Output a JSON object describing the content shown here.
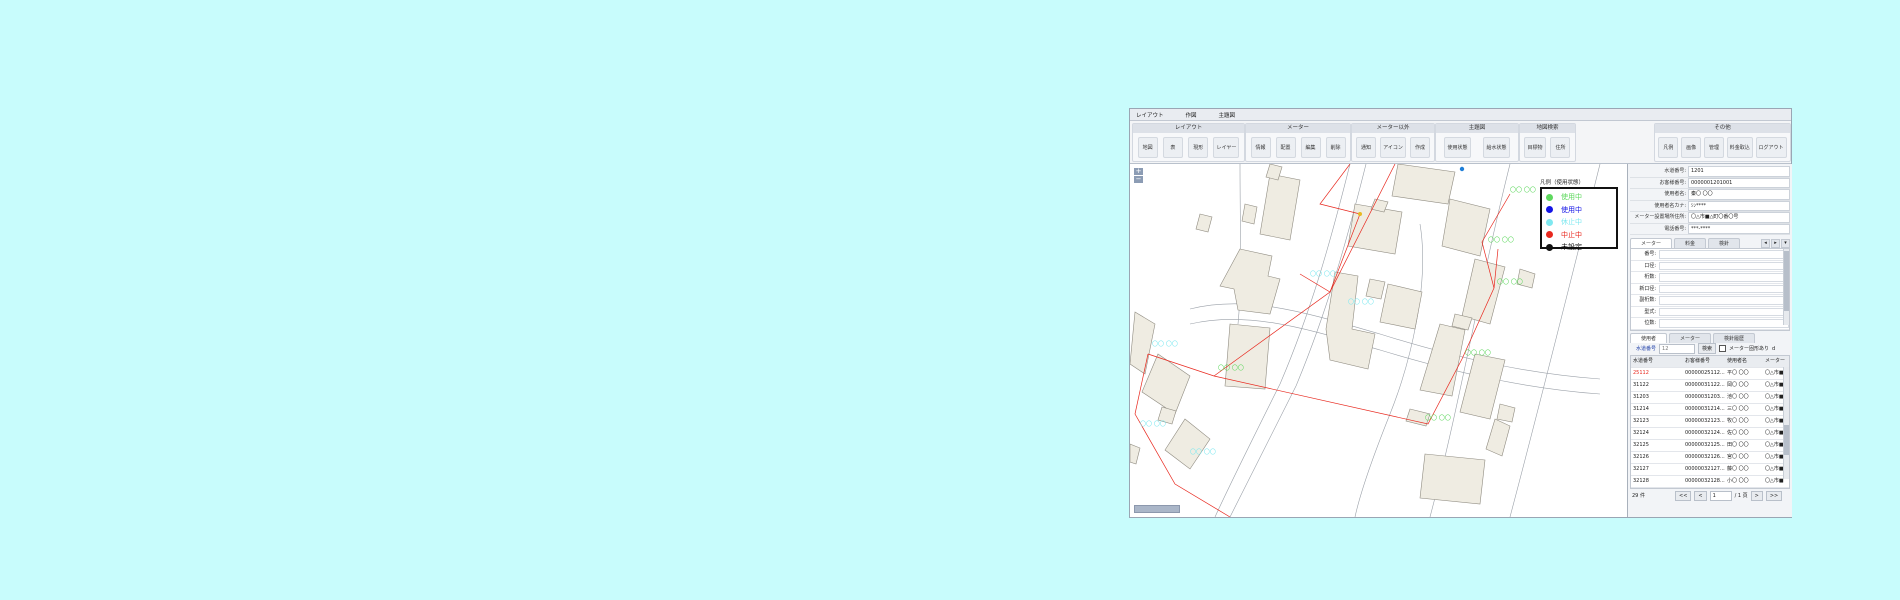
{
  "menubar": [
    "レイアウト",
    "作図",
    "主題図"
  ],
  "ribbon": {
    "groups": [
      {
        "title": "レイアウト",
        "buttons": [
          "地図",
          "表",
          "現形",
          "レイヤー"
        ]
      },
      {
        "title": "メーター",
        "buttons": [
          "情報",
          "配置",
          "編集",
          "削除"
        ]
      },
      {
        "title": "メーター以外",
        "buttons": [
          "通知",
          "アイコン",
          "作成"
        ]
      },
      {
        "title": "主題図",
        "buttons": [
          "使用状態",
          "給水状態"
        ]
      },
      {
        "title": "地図検索",
        "buttons": [
          "目標物",
          "住所"
        ]
      },
      {
        "title": "その他",
        "buttons": [
          "凡例",
          "画像",
          "管理",
          "料金取込",
          "ログアウト"
        ]
      }
    ]
  },
  "map": {
    "zoom_in": "+",
    "zoom_out": "−",
    "legend": {
      "title": "凡例（使用状態）",
      "items": [
        {
          "label": "使用中",
          "color": "#5ed85e"
        },
        {
          "label": "使用中",
          "color": "#1414e6"
        },
        {
          "label": "休止中",
          "color": "#7fe8f0"
        },
        {
          "label": "中止中",
          "color": "#e8281e"
        },
        {
          "label": "未設定",
          "color": "#111111"
        }
      ]
    }
  },
  "info": [
    {
      "label": "水道番号:",
      "value": "1201"
    },
    {
      "label": "お客様番号:",
      "value": "0000001201001"
    },
    {
      "label": "使用者名:",
      "value": "秦〇 〇〇"
    },
    {
      "label": "使用者名カナ:",
      "value": "ｼﾝ****"
    },
    {
      "label": "メーター設置場所住所:",
      "value": "〇△市■△町〇番〇号"
    },
    {
      "label": "電話番号:",
      "value": "***-****"
    }
  ],
  "meter_tabs": {
    "tabs": [
      "メーター",
      "料金",
      "検針"
    ],
    "arrows": [
      "◂",
      "▸",
      "▾"
    ]
  },
  "meter_fields": [
    "番号:",
    "口径:",
    "桁数:",
    "新口径:",
    "副桁数:",
    "型式:",
    "位数:"
  ],
  "list_tabs": [
    "使用者",
    "メーター",
    "検針履歴"
  ],
  "search": {
    "label": "水道番号",
    "placeholder": "12",
    "button": "検索",
    "checkbox_label": "メーター固形あり",
    "extra": "d"
  },
  "table": {
    "headers": [
      "水道番号",
      "お客様番号",
      "使用者名",
      "メーター"
    ],
    "rows": [
      {
        "no": "25112",
        "customer": "00000025112...",
        "name": "平〇 〇〇",
        "addr": "〇△市■",
        "highlight": true
      },
      {
        "no": "31122",
        "customer": "00000031122...",
        "name": "岡〇 〇〇",
        "addr": "〇△市■",
        "highlight": false
      },
      {
        "no": "31203",
        "customer": "00000031203...",
        "name": "池〇 〇〇",
        "addr": "〇△市■",
        "highlight": false
      },
      {
        "no": "31214",
        "customer": "00000031214...",
        "name": "三〇 〇〇",
        "addr": "〇△市■",
        "highlight": false
      },
      {
        "no": "32123",
        "customer": "00000032123...",
        "name": "牧〇 〇〇",
        "addr": "〇△市■",
        "highlight": false
      },
      {
        "no": "32124",
        "customer": "00000032124...",
        "name": "佐〇 〇〇",
        "addr": "〇△市■",
        "highlight": false
      },
      {
        "no": "32125",
        "customer": "00000032125...",
        "name": "田〇 〇〇",
        "addr": "〇△市■",
        "highlight": false
      },
      {
        "no": "32126",
        "customer": "00000032126...",
        "name": "宮〇 〇〇",
        "addr": "〇△市■",
        "highlight": false
      },
      {
        "no": "32127",
        "customer": "00000032127...",
        "name": "藤〇 〇〇",
        "addr": "〇△市■",
        "highlight": false
      },
      {
        "no": "32128",
        "customer": "00000032128...",
        "name": "小〇 〇〇",
        "addr": "〇△市■",
        "highlight": false
      }
    ]
  },
  "pager": {
    "count": "29 件",
    "first": "<<",
    "prev": "<",
    "page": "1",
    "of": "/ 1 頁",
    "next": ">",
    "last": ">>"
  },
  "colors": {
    "accent": "#e8281e",
    "highlight_text": "#e8281e"
  }
}
